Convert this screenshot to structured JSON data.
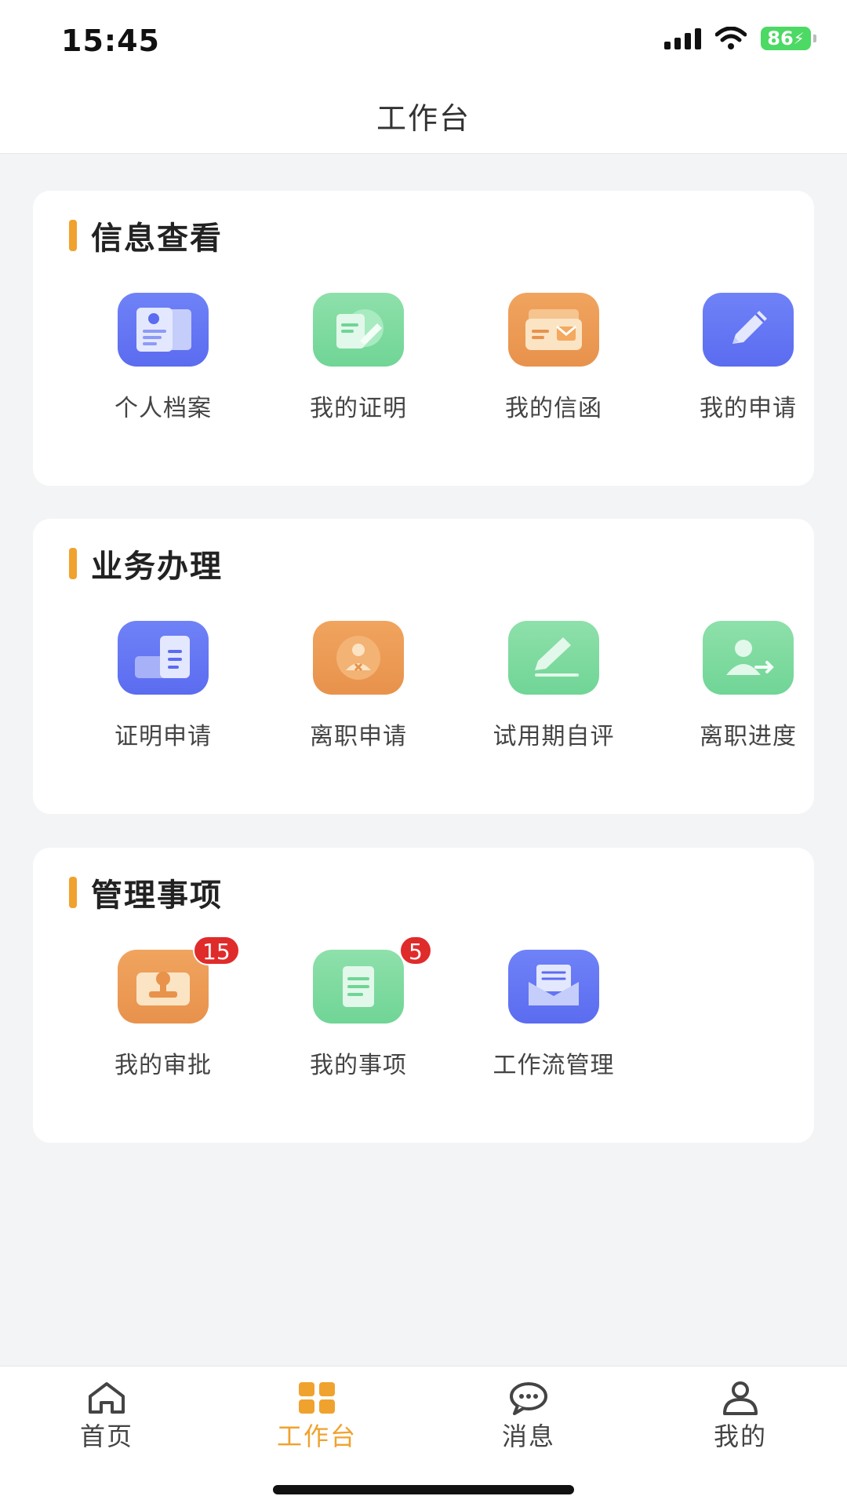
{
  "status_bar": {
    "time": "15:45",
    "battery": "86"
  },
  "nav": {
    "title": "工作台"
  },
  "sections": [
    {
      "title": "信息查看",
      "items": [
        {
          "label": "个人档案",
          "icon": "personal-file-icon",
          "color": "#5b6cf0"
        },
        {
          "label": "我的证明",
          "icon": "certificate-edit-icon",
          "color": "#70d596"
        },
        {
          "label": "我的信函",
          "icon": "letter-tray-icon",
          "color": "#e8924c"
        },
        {
          "label": "我的申请",
          "icon": "pencil-icon",
          "color": "#5b6cf0"
        }
      ]
    },
    {
      "title": "业务办理",
      "items": [
        {
          "label": "证明申请",
          "icon": "document-request-icon",
          "color": "#5b6cf0"
        },
        {
          "label": "离职申请",
          "icon": "person-remove-icon",
          "color": "#e8924c"
        },
        {
          "label": "试用期自评",
          "icon": "pen-write-icon",
          "color": "#70d596"
        },
        {
          "label": "离职进度",
          "icon": "person-arrow-icon",
          "color": "#70d596"
        }
      ]
    },
    {
      "title": "管理事项",
      "items": [
        {
          "label": "我的审批",
          "icon": "stamp-icon",
          "color": "#e8924c",
          "badge": "15"
        },
        {
          "label": "我的事项",
          "icon": "note-icon",
          "color": "#70d596",
          "badge": "5"
        },
        {
          "label": "工作流管理",
          "icon": "mail-open-icon",
          "color": "#5b6cf0"
        }
      ]
    }
  ],
  "tabbar": {
    "items": [
      {
        "label": "首页",
        "icon": "home-icon"
      },
      {
        "label": "工作台",
        "icon": "grid-icon",
        "active": true
      },
      {
        "label": "消息",
        "icon": "chat-bubble-icon"
      },
      {
        "label": "我的",
        "icon": "person-icon"
      }
    ],
    "active_color": "#f0a22e"
  },
  "accent_color": "#f0a22e"
}
